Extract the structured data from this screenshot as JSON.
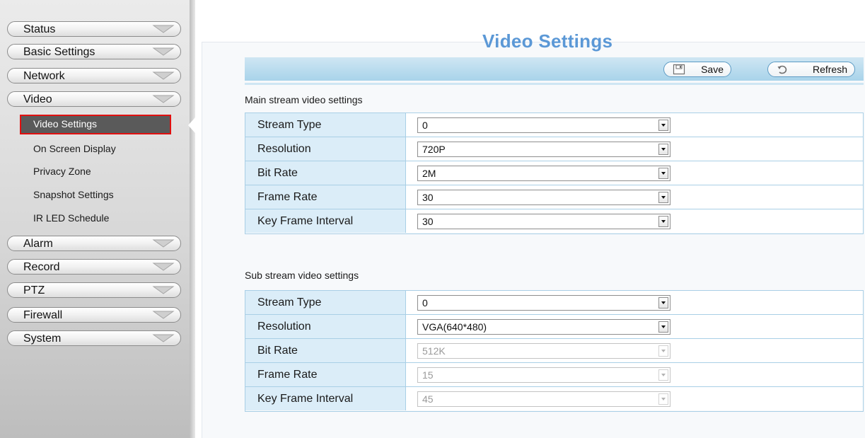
{
  "sidebar": {
    "menus": {
      "status": "Status",
      "basic_settings": "Basic Settings",
      "network": "Network",
      "video": "Video",
      "alarm": "Alarm",
      "record": "Record",
      "ptz": "PTZ",
      "firewall": "Firewall",
      "system": "System"
    },
    "video_submenu": {
      "video_settings": "Video Settings",
      "on_screen_display": "On Screen Display",
      "privacy_zone": "Privacy Zone",
      "snapshot_settings": "Snapshot Settings",
      "ir_led_schedule": "IR LED Schedule"
    },
    "active_item": "Video Settings"
  },
  "page": {
    "title": "Video Settings"
  },
  "toolbar": {
    "save_label": "Save",
    "refresh_label": "Refresh"
  },
  "main_stream": {
    "title": "Main stream video settings",
    "rows": [
      {
        "label": "Stream Type",
        "value": "0",
        "enabled": true
      },
      {
        "label": "Resolution",
        "value": "720P",
        "enabled": true
      },
      {
        "label": "Bit Rate",
        "value": "2M",
        "enabled": true
      },
      {
        "label": "Frame Rate",
        "value": "30",
        "enabled": true
      },
      {
        "label": "Key Frame Interval",
        "value": "30",
        "enabled": true
      }
    ]
  },
  "sub_stream": {
    "title": "Sub stream video settings",
    "rows": [
      {
        "label": "Stream Type",
        "value": "0",
        "enabled": true
      },
      {
        "label": "Resolution",
        "value": "VGA(640*480)",
        "enabled": true
      },
      {
        "label": "Bit Rate",
        "value": "512K",
        "enabled": false
      },
      {
        "label": "Frame Rate",
        "value": "15",
        "enabled": false
      },
      {
        "label": "Key Frame Interval",
        "value": "45",
        "enabled": false
      }
    ]
  },
  "colors": {
    "title_blue": "#5b98d6",
    "toolbar_blue": "#a8d3ea",
    "label_cell_blue": "#dbedf8",
    "active_highlight_border": "#e01010",
    "active_item_bg": "#5a5a5a"
  },
  "icons": {
    "menu_expand": "chevron-down-icon",
    "save": "save-icon",
    "refresh": "refresh-icon",
    "dropdown": "dropdown-arrow-icon"
  }
}
